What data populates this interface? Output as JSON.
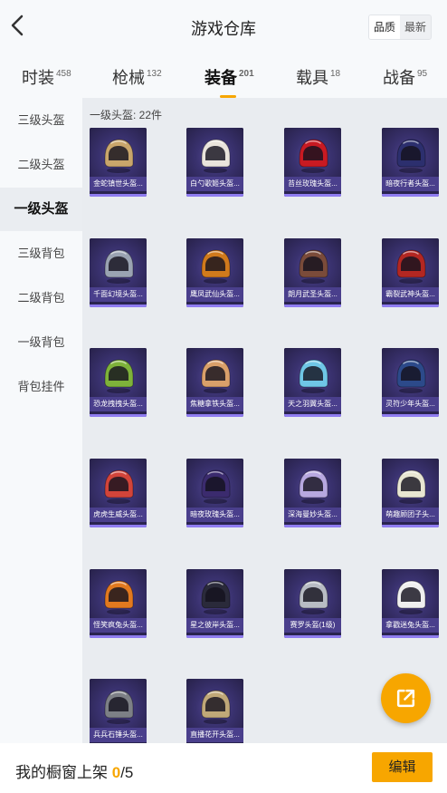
{
  "header": {
    "title": "游戏仓库",
    "sort_options": [
      "品质",
      "最新"
    ]
  },
  "tabs": [
    {
      "label": "时装",
      "count": "458"
    },
    {
      "label": "枪械",
      "count": "132"
    },
    {
      "label": "装备",
      "count": "201"
    },
    {
      "label": "载具",
      "count": "18"
    },
    {
      "label": "战备",
      "count": "95"
    }
  ],
  "sidebar": {
    "items": [
      "三级头盔",
      "二级头盔",
      "一级头盔",
      "三级背包",
      "二级背包",
      "一级背包",
      "背包挂件"
    ]
  },
  "main": {
    "count_label": "一级头盔: 22件",
    "items": [
      {
        "name": "金蛇镇世头盔...",
        "color": "#c9a66b"
      },
      {
        "name": "白勺歌姬头盔...",
        "color": "#e9e4dc"
      },
      {
        "name": "苔丝玫瑰头盔...",
        "color": "#c81a22"
      },
      {
        "name": "暗夜行者头盔...",
        "color": "#2c2f6e"
      },
      {
        "name": "千面幻境头盔...",
        "color": "#9aa3b2"
      },
      {
        "name": "鹰凤武仙头盔...",
        "color": "#d07a1c"
      },
      {
        "name": "朗月武圣头盔...",
        "color": "#7a4b3a"
      },
      {
        "name": "霸裂武神头盔...",
        "color": "#b32722"
      },
      {
        "name": "恐龙拽拽头盔...",
        "color": "#7eb23a"
      },
      {
        "name": "焦糖拿铁头盔...",
        "color": "#d9a06a"
      },
      {
        "name": "天之羽翼头盔...",
        "color": "#6fc6e6"
      },
      {
        "name": "灵符少年头盔...",
        "color": "#2c4a8a"
      },
      {
        "name": "虎虎生威头盔...",
        "color": "#d2443a"
      },
      {
        "name": "暗夜玫瑰头盔...",
        "color": "#3b2b6e"
      },
      {
        "name": "深海曼妙头盔...",
        "color": "#b7a8e0"
      },
      {
        "name": "萌趣顾团子头...",
        "color": "#e8e6d2"
      },
      {
        "name": "怪笑疯兔头盔...",
        "color": "#e2791f"
      },
      {
        "name": "星之彼岸头盔...",
        "color": "#2a2a3a"
      },
      {
        "name": "赛罗头盔(1级)",
        "color": "#b8bcc4"
      },
      {
        "name": "拿戳迷兔头盔...",
        "color": "#efefef"
      },
      {
        "name": "兵兵石锤头盔...",
        "color": "#7d8086"
      },
      {
        "name": "直播花开头盔...",
        "color": "#c0a878"
      }
    ]
  },
  "footer": {
    "label_prefix": "我的橱窗上架",
    "shown": "0",
    "total": "/5",
    "edit_label": "编辑"
  },
  "colors": {
    "accent": "#f7a600",
    "card_bg": "#2a2450",
    "card_label": "#4a3f8c"
  }
}
